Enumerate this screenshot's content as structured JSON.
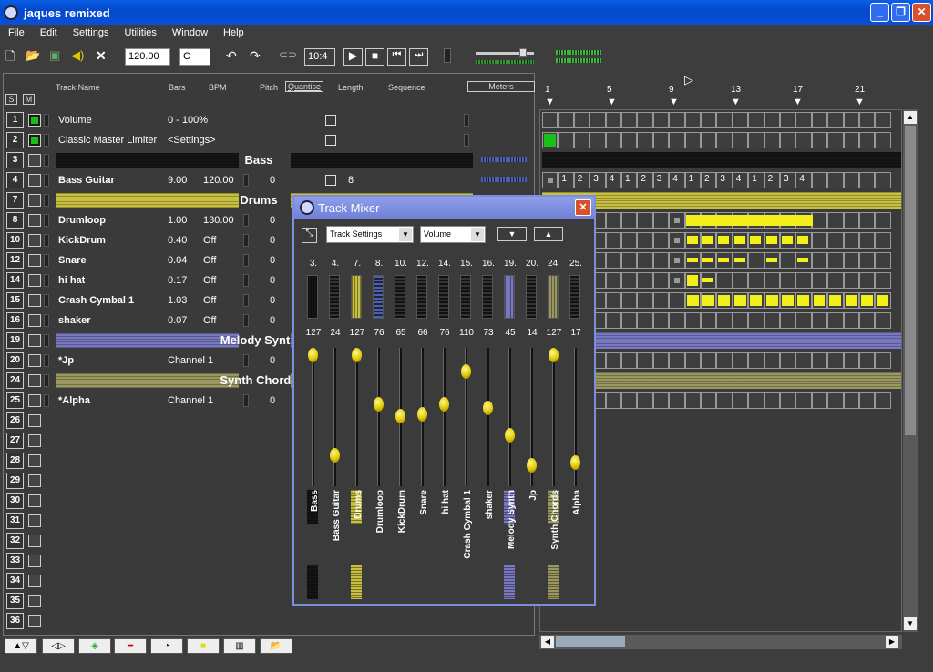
{
  "window": {
    "title": "jaques remixed"
  },
  "menu": [
    "File",
    "Edit",
    "Settings",
    "Utilities",
    "Window",
    "Help"
  ],
  "toolbar": {
    "tempo": "120.00",
    "key": "C",
    "time_signature": "10:4"
  },
  "track_headers": {
    "name": "Track Name",
    "bars": "Bars",
    "bpm": "BPM",
    "pitch": "Pitch",
    "quantise": "Quantise",
    "length": "Length",
    "sequence": "Sequence",
    "meters": "Meters",
    "solo": "S",
    "mute": "M"
  },
  "tracks": [
    {
      "num": "1",
      "name": "Volume",
      "bars": "0 - 100%",
      "bpm": "",
      "pitch": "",
      "length": "",
      "kind": "plain"
    },
    {
      "num": "2",
      "name": "Classic Master Limiter",
      "bars": "<Settings>",
      "bpm": "",
      "pitch": "",
      "length": "",
      "kind": "plain"
    },
    {
      "num": "3",
      "name": "Bass",
      "kind": "group",
      "band": "#151515"
    },
    {
      "num": "4",
      "name": "Bass Guitar",
      "bars": "9.00",
      "bpm": "120.00",
      "pitch": "0",
      "length": "8",
      "kind": "bold"
    },
    {
      "num": "7",
      "name": "Drums",
      "kind": "group",
      "band": "#c8c040"
    },
    {
      "num": "8",
      "name": "Drumloop",
      "bars": "1.00",
      "bpm": "130.00",
      "pitch": "0",
      "kind": "bold"
    },
    {
      "num": "10",
      "name": "KickDrum",
      "bars": "0.40",
      "bpm": "Off",
      "pitch": "0",
      "kind": "bold"
    },
    {
      "num": "12",
      "name": "Snare",
      "bars": "0.04",
      "bpm": "Off",
      "pitch": "0",
      "kind": "bold"
    },
    {
      "num": "14",
      "name": "hi hat",
      "bars": "0.17",
      "bpm": "Off",
      "pitch": "0",
      "kind": "bold"
    },
    {
      "num": "15",
      "name": "Crash Cymbal 1",
      "bars": "1.03",
      "bpm": "Off",
      "pitch": "0",
      "kind": "bold"
    },
    {
      "num": "16",
      "name": "shaker",
      "bars": "0.07",
      "bpm": "Off",
      "pitch": "0",
      "kind": "bold"
    },
    {
      "num": "19",
      "name": "Melody Synth",
      "kind": "group",
      "band": "#7878c0"
    },
    {
      "num": "20",
      "name": "*Jp",
      "bars": "Channel 1",
      "bpm": "",
      "pitch": "0",
      "kind": "bold"
    },
    {
      "num": "24",
      "name": "Synth Chords",
      "kind": "group",
      "band": "#9a9860"
    },
    {
      "num": "25",
      "name": "*Alpha",
      "bars": "Channel 1",
      "bpm": "",
      "pitch": "0",
      "kind": "bold"
    },
    {
      "num": "26",
      "kind": "empty"
    },
    {
      "num": "27",
      "kind": "empty"
    },
    {
      "num": "28",
      "kind": "empty"
    },
    {
      "num": "29",
      "kind": "empty"
    },
    {
      "num": "30",
      "kind": "empty"
    },
    {
      "num": "31",
      "kind": "empty"
    },
    {
      "num": "32",
      "kind": "empty"
    },
    {
      "num": "33",
      "kind": "empty"
    },
    {
      "num": "34",
      "kind": "empty"
    },
    {
      "num": "35",
      "kind": "empty"
    },
    {
      "num": "36",
      "kind": "empty"
    }
  ],
  "group_labels": {
    "bass": "Bass",
    "drums": "Drums",
    "melody": "Melody Synth",
    "chords": "Synth Chords"
  },
  "sequence": {
    "bar_markers": [
      "1",
      "5",
      "9",
      "13",
      "17",
      "21"
    ],
    "bass_steps": [
      "1",
      "2",
      "3",
      "4",
      "1",
      "2",
      "3",
      "4",
      "1",
      "2",
      "3",
      "4",
      "1",
      "2",
      "3",
      "4"
    ]
  },
  "mixer": {
    "title": "Track Mixer",
    "settings_select": "Track Settings",
    "param_select": "Volume",
    "channels": [
      {
        "num": "3.",
        "val": "127",
        "name": "Bass",
        "level": 1.0
      },
      {
        "num": "4.",
        "val": "24",
        "name": "Bass Guitar",
        "level": 0.19
      },
      {
        "num": "7.",
        "val": "127",
        "name": "Drums",
        "level": 1.0
      },
      {
        "num": "8.",
        "val": "76",
        "name": "Drumloop",
        "level": 0.6
      },
      {
        "num": "10.",
        "val": "65",
        "name": "KickDrum",
        "level": 0.51
      },
      {
        "num": "12.",
        "val": "66",
        "name": "Snare",
        "level": 0.52
      },
      {
        "num": "14.",
        "val": "76",
        "name": "hi hat",
        "level": 0.6
      },
      {
        "num": "15.",
        "val": "110",
        "name": "Crash Cymbal 1",
        "level": 0.87
      },
      {
        "num": "16.",
        "val": "73",
        "name": "shaker",
        "level": 0.57
      },
      {
        "num": "19.",
        "val": "45",
        "name": "Melody Synth",
        "level": 0.35
      },
      {
        "num": "20.",
        "val": "14",
        "name": "Jp",
        "level": 0.11
      },
      {
        "num": "24.",
        "val": "127",
        "name": "Synth Chords",
        "level": 1.0
      },
      {
        "num": "25.",
        "val": "17",
        "name": "Alpha",
        "level": 0.13
      }
    ]
  }
}
